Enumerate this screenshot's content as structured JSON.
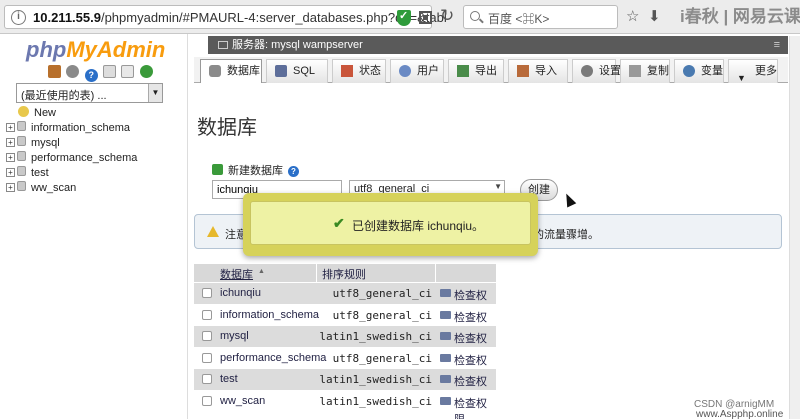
{
  "browser": {
    "url_prefix": "10.211.55.9",
    "url_rest": "/phpmyadmin/#PMAURL-4:server_databases.php?db=&tabl",
    "search_placeholder": "百度 <⌘K>",
    "watermark": "i春秋 | 网易云课堂"
  },
  "nav": {
    "logo_php": "php",
    "logo_myadmin": "MyAdmin",
    "recent_select": "(最近使用的表) ...",
    "new_label": "New",
    "databases": [
      "information_schema",
      "mysql",
      "performance_schema",
      "test",
      "ww_scan"
    ]
  },
  "server_bar": {
    "label": "服务器: mysql wampserver"
  },
  "tabs": [
    {
      "label": "数据库",
      "icon": "database-icon"
    },
    {
      "label": "SQL",
      "icon": "sql-icon"
    },
    {
      "label": "状态",
      "icon": "status-icon"
    },
    {
      "label": "用户",
      "icon": "users-icon"
    },
    {
      "label": "导出",
      "icon": "export-icon"
    },
    {
      "label": "导入",
      "icon": "import-icon"
    },
    {
      "label": "设置",
      "icon": "settings-icon"
    },
    {
      "label": "复制",
      "icon": "replication-icon"
    },
    {
      "label": "变量",
      "icon": "variables-icon"
    },
    {
      "label": "更多",
      "icon": "chevron-down-icon"
    }
  ],
  "main": {
    "title": "数据库",
    "create_label": "新建数据库",
    "db_name_value": "ichunqiu",
    "collation_value": "utf8_general_ci",
    "create_button": "创建",
    "notice_start": "注意",
    "notice_end": "的流量骤增。",
    "success_message": "已创建数据库 ichunqiu。"
  },
  "table": {
    "headers": {
      "name": "数据库",
      "collation": "排序规则"
    },
    "check_privileges": "检查权限",
    "rows": [
      {
        "name": "ichunqiu",
        "collation": "utf8_general_ci"
      },
      {
        "name": "information_schema",
        "collation": "utf8_general_ci"
      },
      {
        "name": "mysql",
        "collation": "latin1_swedish_ci"
      },
      {
        "name": "performance_schema",
        "collation": "utf8_general_ci"
      },
      {
        "name": "test",
        "collation": "latin1_swedish_ci"
      },
      {
        "name": "ww_scan",
        "collation": "latin1_swedish_ci"
      }
    ]
  },
  "footer": {
    "csdn": "CSDN @arnigMM",
    "site": "www.Aspphp.online"
  },
  "colors": {
    "logo_php": "#6c78af",
    "logo_myadmin": "#f89c0e",
    "success_bg": "#eef2a4",
    "success_border": "#d6d25a",
    "server_bar_bg": "#5a5a5a"
  }
}
